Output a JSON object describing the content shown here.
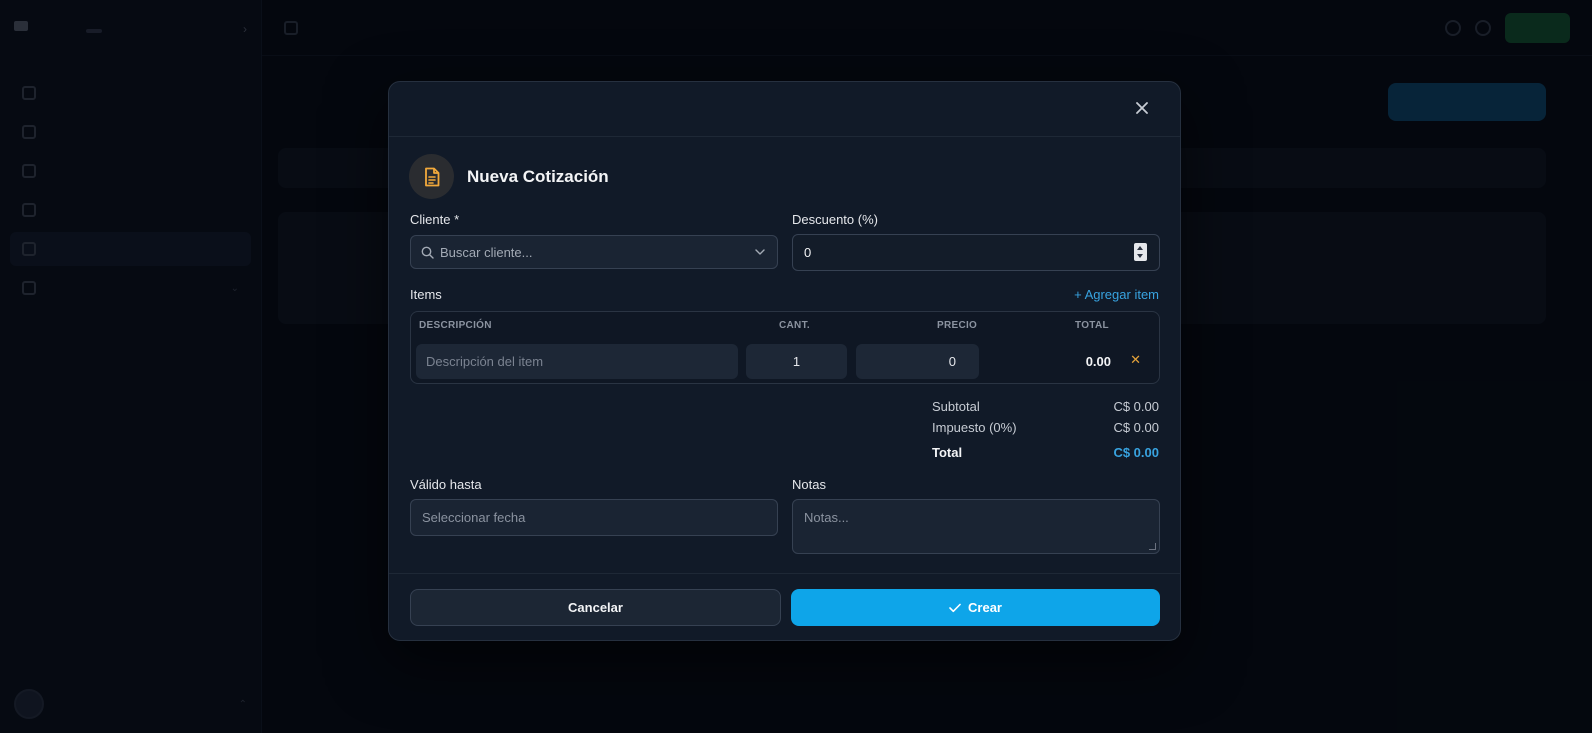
{
  "modal": {
    "title": "Nueva Cotización",
    "client_label": "Cliente *",
    "client_placeholder": "Buscar cliente...",
    "discount_label": "Descuento (%)",
    "discount_value": "0",
    "items_label": "Items",
    "add_item_label": "+ Agregar item",
    "items_columns": [
      "DESCRIPCIÓN",
      "CANT.",
      "PRECIO",
      "TOTAL"
    ],
    "item_row": {
      "description_placeholder": "Descripción del item",
      "quantity": "1",
      "price": "0",
      "total": "0.00",
      "delete_glyph": "✕"
    },
    "summary": {
      "subtotal_label": "Subtotal",
      "subtotal_value": "C$ 0.00",
      "tax_label": "Impuesto (0%)",
      "tax_value": "C$ 0.00",
      "total_label": "Total",
      "total_value": "C$ 0.00"
    },
    "valid_until_label": "Válido hasta",
    "valid_until_placeholder": "Seleccionar fecha",
    "notes_label": "Notas",
    "notes_placeholder": "Notas...",
    "cancel_label": "Cancelar",
    "create_label": "Crear"
  },
  "colors": {
    "accent": "#0ea5e9",
    "accent_text": "#38a3e0",
    "icon_amber": "#f2a93b",
    "delete_amber": "#e3a23a",
    "modal_bg": "#111a28"
  },
  "icons": [
    "close-icon",
    "document-icon",
    "search-icon",
    "chevron-down-icon",
    "delete-x-icon",
    "check-icon"
  ]
}
